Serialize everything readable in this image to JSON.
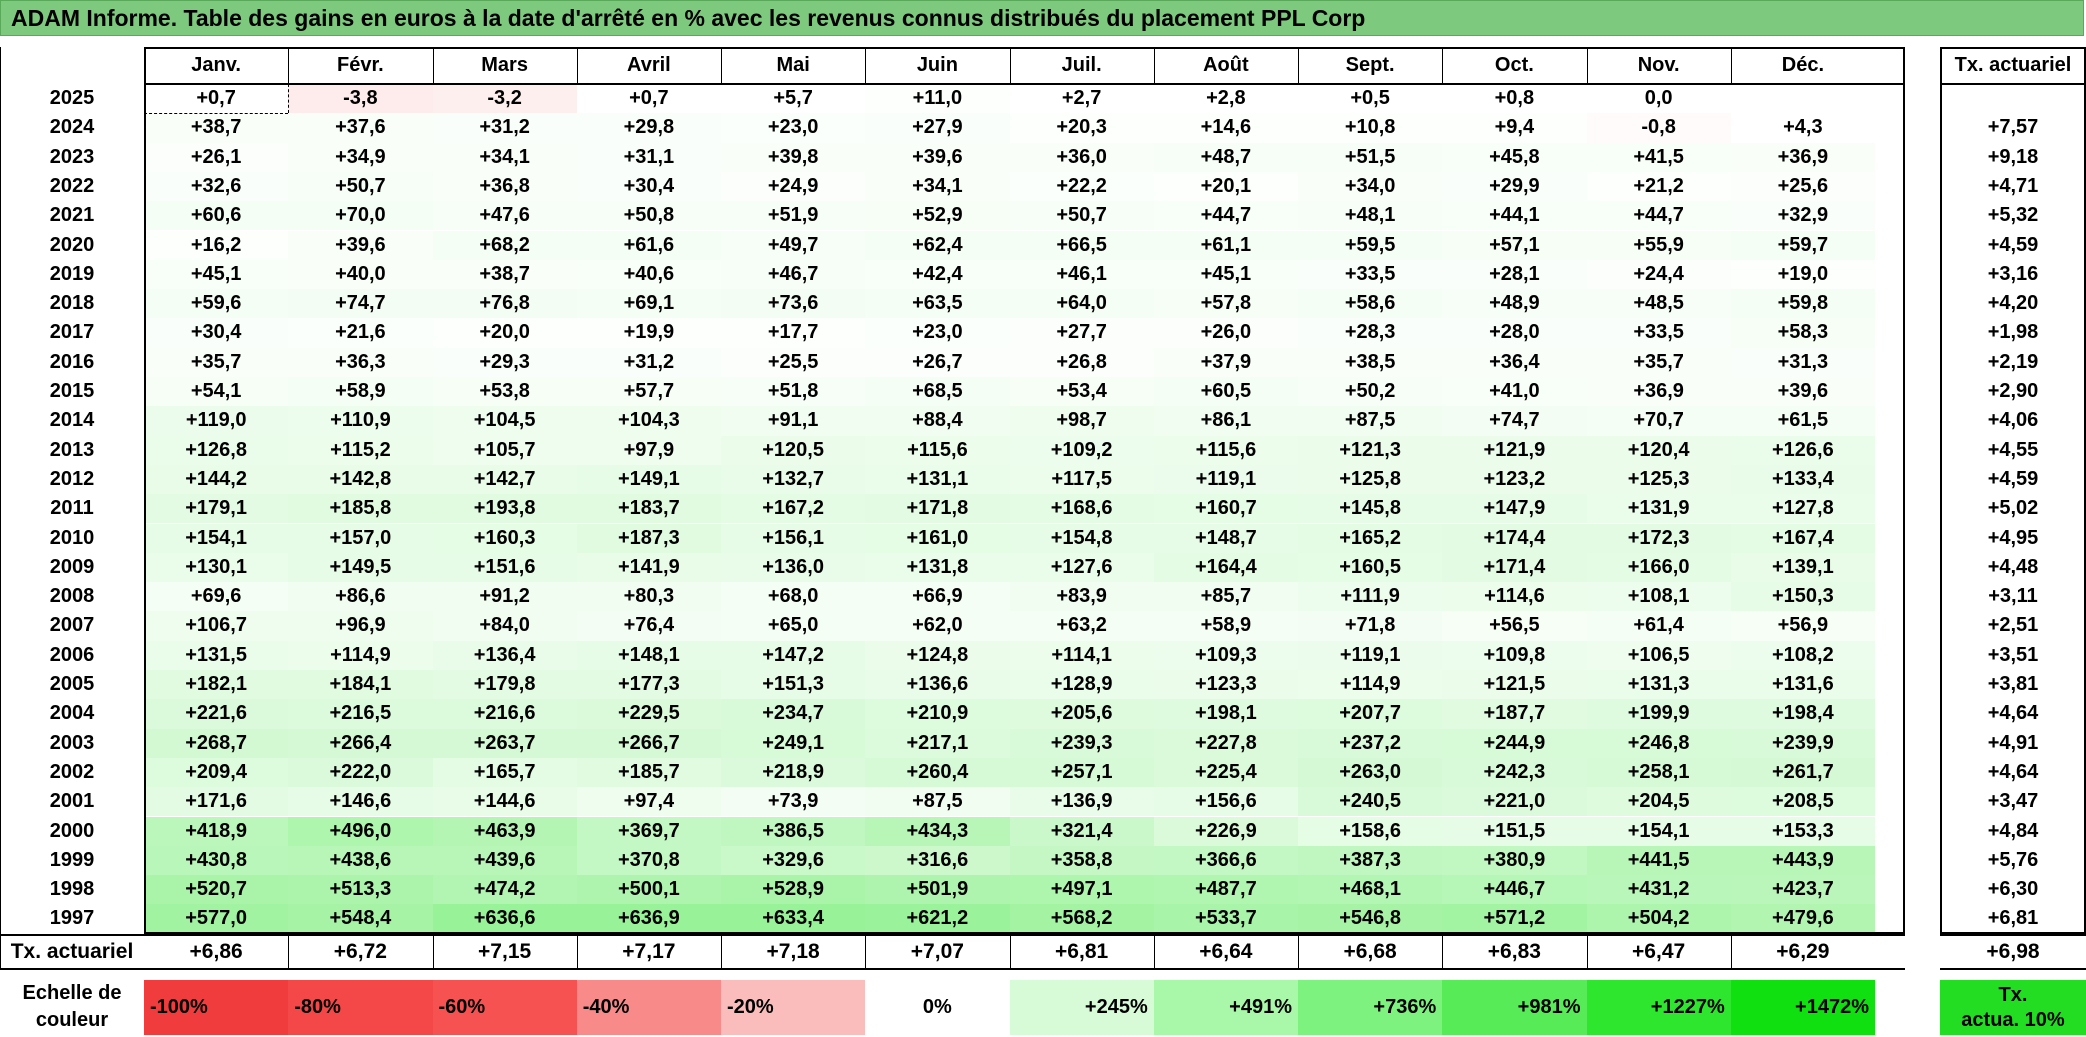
{
  "title": "ADAM Informe. Table des gains en euros à la date d'arrêté en % avec les revenus connus distribués du placement PPL Corp",
  "table": {
    "months": [
      "Janv.",
      "Févr.",
      "Mars",
      "Avril",
      "Mai",
      "Juin",
      "Juil.",
      "Août",
      "Sept.",
      "Oct.",
      "Nov.",
      "Déc."
    ],
    "tx_header": "Tx. actuariel",
    "rows": [
      {
        "year": "2025",
        "values": [
          "+0,7",
          "-3,8",
          "-3,2",
          "+0,7",
          "+5,7",
          "+11,0",
          "+2,7",
          "+2,8",
          "+0,5",
          "+0,8",
          "0,0",
          ""
        ],
        "tx": ""
      },
      {
        "year": "2024",
        "values": [
          "+38,7",
          "+37,6",
          "+31,2",
          "+29,8",
          "+23,0",
          "+27,9",
          "+20,3",
          "+14,6",
          "+10,8",
          "+9,4",
          "-0,8",
          "+4,3"
        ],
        "tx": "+7,57"
      },
      {
        "year": "2023",
        "values": [
          "+26,1",
          "+34,9",
          "+34,1",
          "+31,1",
          "+39,8",
          "+39,6",
          "+36,0",
          "+48,7",
          "+51,5",
          "+45,8",
          "+41,5",
          "+36,9"
        ],
        "tx": "+9,18"
      },
      {
        "year": "2022",
        "values": [
          "+32,6",
          "+50,7",
          "+36,8",
          "+30,4",
          "+24,9",
          "+34,1",
          "+22,2",
          "+20,1",
          "+34,0",
          "+29,9",
          "+21,2",
          "+25,6"
        ],
        "tx": "+4,71"
      },
      {
        "year": "2021",
        "values": [
          "+60,6",
          "+70,0",
          "+47,6",
          "+50,8",
          "+51,9",
          "+52,9",
          "+50,7",
          "+44,7",
          "+48,1",
          "+44,1",
          "+44,7",
          "+32,9"
        ],
        "tx": "+5,32"
      },
      {
        "year": "2020",
        "values": [
          "+16,2",
          "+39,6",
          "+68,2",
          "+61,6",
          "+49,7",
          "+62,4",
          "+66,5",
          "+61,1",
          "+59,5",
          "+57,1",
          "+55,9",
          "+59,7"
        ],
        "tx": "+4,59"
      },
      {
        "year": "2019",
        "values": [
          "+45,1",
          "+40,0",
          "+38,7",
          "+40,6",
          "+46,7",
          "+42,4",
          "+46,1",
          "+45,1",
          "+33,5",
          "+28,1",
          "+24,4",
          "+19,0"
        ],
        "tx": "+3,16"
      },
      {
        "year": "2018",
        "values": [
          "+59,6",
          "+74,7",
          "+76,8",
          "+69,1",
          "+73,6",
          "+63,5",
          "+64,0",
          "+57,8",
          "+58,6",
          "+48,9",
          "+48,5",
          "+59,8"
        ],
        "tx": "+4,20"
      },
      {
        "year": "2017",
        "values": [
          "+30,4",
          "+21,6",
          "+20,0",
          "+19,9",
          "+17,7",
          "+23,0",
          "+27,7",
          "+26,0",
          "+28,3",
          "+28,0",
          "+33,5",
          "+58,3"
        ],
        "tx": "+1,98"
      },
      {
        "year": "2016",
        "values": [
          "+35,7",
          "+36,3",
          "+29,3",
          "+31,2",
          "+25,5",
          "+26,7",
          "+26,8",
          "+37,9",
          "+38,5",
          "+36,4",
          "+35,7",
          "+31,3"
        ],
        "tx": "+2,19"
      },
      {
        "year": "2015",
        "values": [
          "+54,1",
          "+58,9",
          "+53,8",
          "+57,7",
          "+51,8",
          "+68,5",
          "+53,4",
          "+60,5",
          "+50,2",
          "+41,0",
          "+36,9",
          "+39,6"
        ],
        "tx": "+2,90"
      },
      {
        "year": "2014",
        "values": [
          "+119,0",
          "+110,9",
          "+104,5",
          "+104,3",
          "+91,1",
          "+88,4",
          "+98,7",
          "+86,1",
          "+87,5",
          "+74,7",
          "+70,7",
          "+61,5"
        ],
        "tx": "+4,06"
      },
      {
        "year": "2013",
        "values": [
          "+126,8",
          "+115,2",
          "+105,7",
          "+97,9",
          "+120,5",
          "+115,6",
          "+109,2",
          "+115,6",
          "+121,3",
          "+121,9",
          "+120,4",
          "+126,6"
        ],
        "tx": "+4,55"
      },
      {
        "year": "2012",
        "values": [
          "+144,2",
          "+142,8",
          "+142,7",
          "+149,1",
          "+132,7",
          "+131,1",
          "+117,5",
          "+119,1",
          "+125,8",
          "+123,2",
          "+125,3",
          "+133,4"
        ],
        "tx": "+4,59"
      },
      {
        "year": "2011",
        "values": [
          "+179,1",
          "+185,8",
          "+193,8",
          "+183,7",
          "+167,2",
          "+171,8",
          "+168,6",
          "+160,7",
          "+145,8",
          "+147,9",
          "+131,9",
          "+127,8"
        ],
        "tx": "+5,02"
      },
      {
        "year": "2010",
        "values": [
          "+154,1",
          "+157,0",
          "+160,3",
          "+187,3",
          "+156,1",
          "+161,0",
          "+154,8",
          "+148,7",
          "+165,2",
          "+174,4",
          "+172,3",
          "+167,4"
        ],
        "tx": "+4,95"
      },
      {
        "year": "2009",
        "values": [
          "+130,1",
          "+149,5",
          "+151,6",
          "+141,9",
          "+136,0",
          "+131,8",
          "+127,6",
          "+164,4",
          "+160,5",
          "+171,4",
          "+166,0",
          "+139,1"
        ],
        "tx": "+4,48"
      },
      {
        "year": "2008",
        "values": [
          "+69,6",
          "+86,6",
          "+91,2",
          "+80,3",
          "+68,0",
          "+66,9",
          "+83,9",
          "+85,7",
          "+111,9",
          "+114,6",
          "+108,1",
          "+150,3"
        ],
        "tx": "+3,11"
      },
      {
        "year": "2007",
        "values": [
          "+106,7",
          "+96,9",
          "+84,0",
          "+76,4",
          "+65,0",
          "+62,0",
          "+63,2",
          "+58,9",
          "+71,8",
          "+56,5",
          "+61,4",
          "+56,9"
        ],
        "tx": "+2,51"
      },
      {
        "year": "2006",
        "values": [
          "+131,5",
          "+114,9",
          "+136,4",
          "+148,1",
          "+147,2",
          "+124,8",
          "+114,1",
          "+109,3",
          "+119,1",
          "+109,8",
          "+106,5",
          "+108,2"
        ],
        "tx": "+3,51"
      },
      {
        "year": "2005",
        "values": [
          "+182,1",
          "+184,1",
          "+179,8",
          "+177,3",
          "+151,3",
          "+136,6",
          "+128,9",
          "+123,3",
          "+114,9",
          "+121,5",
          "+131,3",
          "+131,6"
        ],
        "tx": "+3,81"
      },
      {
        "year": "2004",
        "values": [
          "+221,6",
          "+216,5",
          "+216,6",
          "+229,5",
          "+234,7",
          "+210,9",
          "+205,6",
          "+198,1",
          "+207,7",
          "+187,7",
          "+199,9",
          "+198,4"
        ],
        "tx": "+4,64"
      },
      {
        "year": "2003",
        "values": [
          "+268,7",
          "+266,4",
          "+263,7",
          "+266,7",
          "+249,1",
          "+217,1",
          "+239,3",
          "+227,8",
          "+237,2",
          "+244,9",
          "+246,8",
          "+239,9"
        ],
        "tx": "+4,91"
      },
      {
        "year": "2002",
        "values": [
          "+209,4",
          "+222,0",
          "+165,7",
          "+185,7",
          "+218,9",
          "+260,4",
          "+257,1",
          "+225,4",
          "+263,0",
          "+242,3",
          "+258,1",
          "+261,7"
        ],
        "tx": "+4,64"
      },
      {
        "year": "2001",
        "values": [
          "+171,6",
          "+146,6",
          "+144,6",
          "+97,4",
          "+73,9",
          "+87,5",
          "+136,9",
          "+156,6",
          "+240,5",
          "+221,0",
          "+204,5",
          "+208,5"
        ],
        "tx": "+3,47"
      },
      {
        "year": "2000",
        "values": [
          "+418,9",
          "+496,0",
          "+463,9",
          "+369,7",
          "+386,5",
          "+434,3",
          "+321,4",
          "+226,9",
          "+158,6",
          "+151,5",
          "+154,1",
          "+153,3"
        ],
        "tx": "+4,84"
      },
      {
        "year": "1999",
        "values": [
          "+430,8",
          "+438,6",
          "+439,6",
          "+370,8",
          "+329,6",
          "+316,6",
          "+358,8",
          "+366,6",
          "+387,3",
          "+380,9",
          "+441,5",
          "+443,9"
        ],
        "tx": "+5,76"
      },
      {
        "year": "1998",
        "values": [
          "+520,7",
          "+513,3",
          "+474,2",
          "+500,1",
          "+528,9",
          "+501,9",
          "+497,1",
          "+487,7",
          "+468,1",
          "+446,7",
          "+431,2",
          "+423,7"
        ],
        "tx": "+6,30"
      },
      {
        "year": "1997",
        "values": [
          "+577,0",
          "+548,4",
          "+636,6",
          "+636,9",
          "+633,4",
          "+621,2",
          "+568,2",
          "+533,7",
          "+546,8",
          "+571,2",
          "+504,2",
          "+479,6"
        ],
        "tx": "+6,81"
      }
    ],
    "footer": {
      "label": "Tx. actuariel",
      "values": [
        "+6,86",
        "+6,72",
        "+7,15",
        "+7,17",
        "+7,18",
        "+7,07",
        "+6,81",
        "+6,64",
        "+6,68",
        "+6,83",
        "+6,47",
        "+6,29"
      ],
      "tx": "+6,98"
    }
  },
  "legend": {
    "label_line1": "Echelle de",
    "label_line2": "couleur",
    "steps": [
      {
        "label": "-100%",
        "color": "#f03c3c"
      },
      {
        "label": "-80%",
        "color": "#f44848"
      },
      {
        "label": "-60%",
        "color": "#f65252"
      },
      {
        "label": "-40%",
        "color": "#f98a8a"
      },
      {
        "label": "-20%",
        "color": "#fbbcbc"
      },
      {
        "label": "0%",
        "color": "#ffffff"
      },
      {
        "label": "+245%",
        "color": "#d6fbd6"
      },
      {
        "label": "+491%",
        "color": "#a9f7a9"
      },
      {
        "label": "+736%",
        "color": "#7ef27e"
      },
      {
        "label": "+981%",
        "color": "#57ec57"
      },
      {
        "label": "+1227%",
        "color": "#2fe62f"
      },
      {
        "label": "+1472%",
        "color": "#10e010"
      }
    ],
    "tx_line1": "Tx.",
    "tx_line2": "actua. 10%",
    "tx_color": "#22dd22"
  }
}
